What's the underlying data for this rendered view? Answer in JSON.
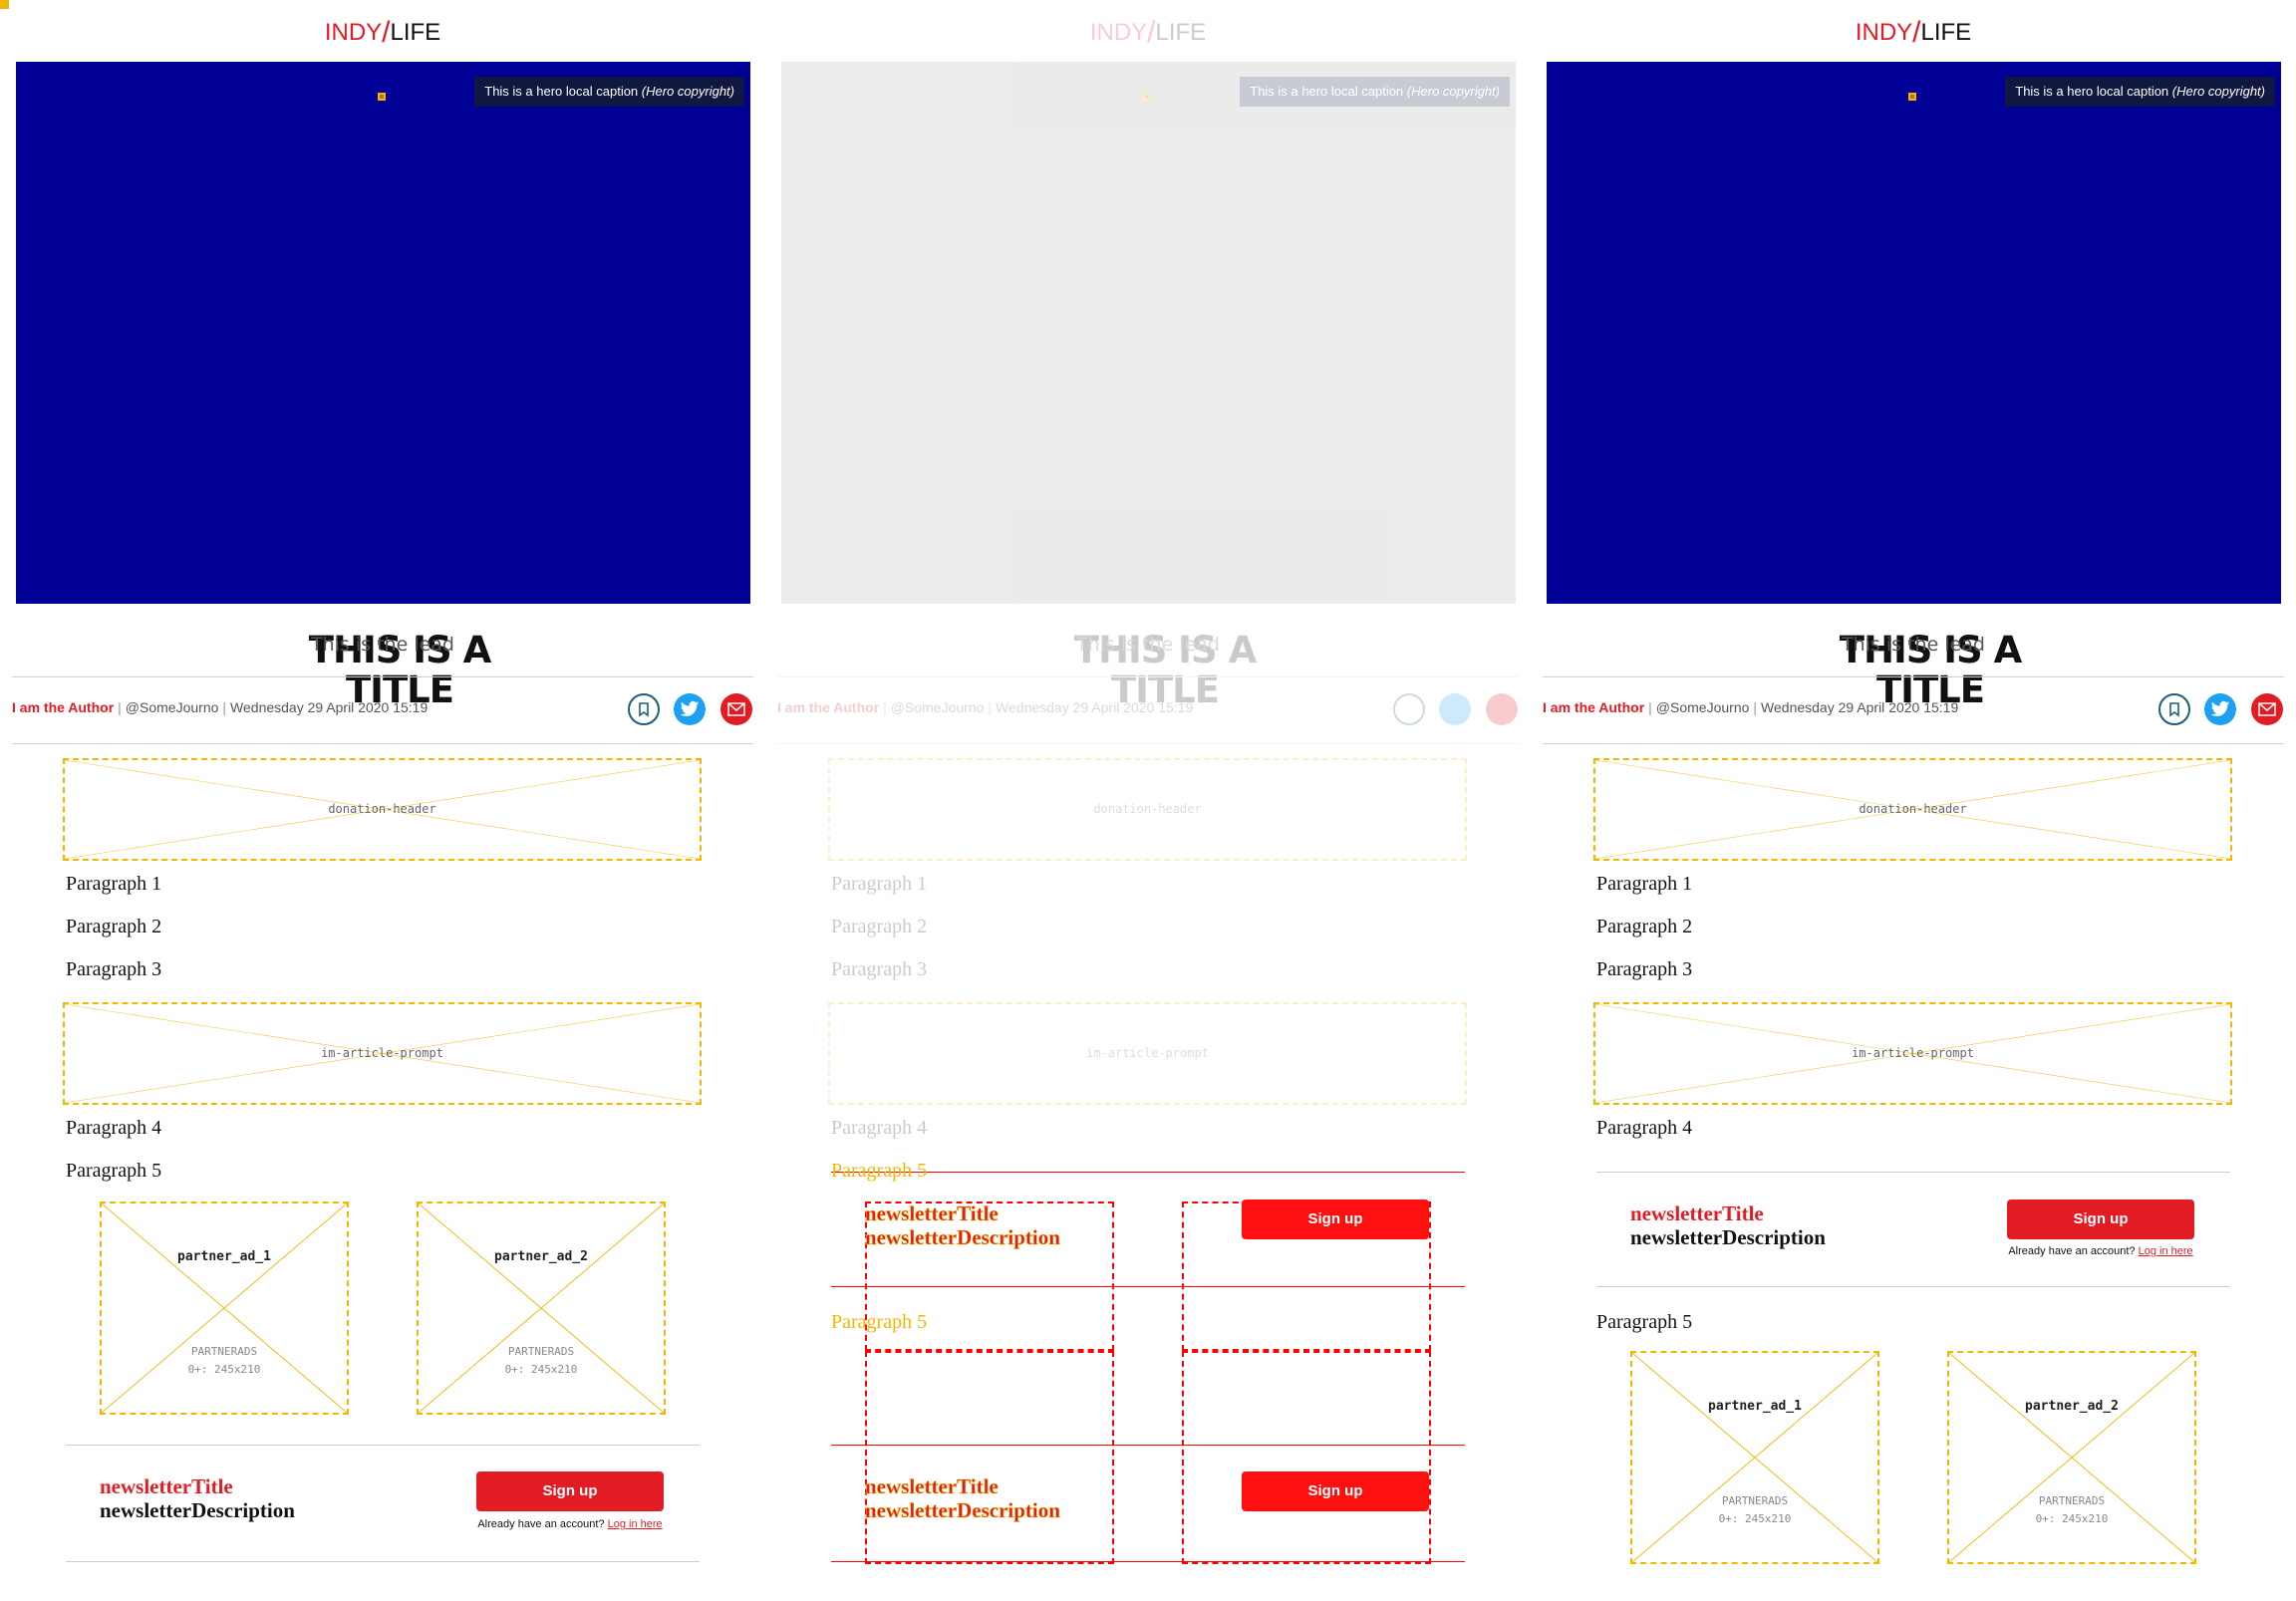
{
  "brand": {
    "indy": "INDY",
    "slash": "/",
    "life": "LIFE"
  },
  "hero": {
    "caption_text": "This is a hero local caption",
    "caption_copyright": "(Hero copyright)",
    "title": "THIS IS A TITLE"
  },
  "lead": "This is the lead",
  "byline": {
    "author": "I am the Author",
    "twitter": "@SomeJourno",
    "date": "Wednesday 29 April 2020 15:19"
  },
  "share": {
    "bookmark_icon": "bookmark-icon",
    "twitter_icon": "twitter-icon",
    "email_icon": "email-icon"
  },
  "placeholders": {
    "donation": "donation-header",
    "prompt": "im-article-prompt"
  },
  "paragraphs": [
    "Paragraph 1",
    "Paragraph 2",
    "Paragraph 3",
    "Paragraph 4",
    "Paragraph 5"
  ],
  "ads": [
    {
      "name": "partner_ad_1",
      "partner": "PARTNERADS",
      "size": "0+: 245x210"
    },
    {
      "name": "partner_ad_2",
      "partner": "PARTNERADS",
      "size": "0+: 245x210"
    }
  ],
  "newsletter": {
    "title": "newsletterTitle",
    "description": "newsletterDescription",
    "signup": "Sign up",
    "account_prompt": "Already have an account?",
    "login": "Log in here"
  },
  "colors": {
    "brand_red": "#e31b23",
    "hero_blue": "#000096",
    "placeholder_orange": "#f3b600",
    "twitter_blue": "#1da1f2"
  }
}
